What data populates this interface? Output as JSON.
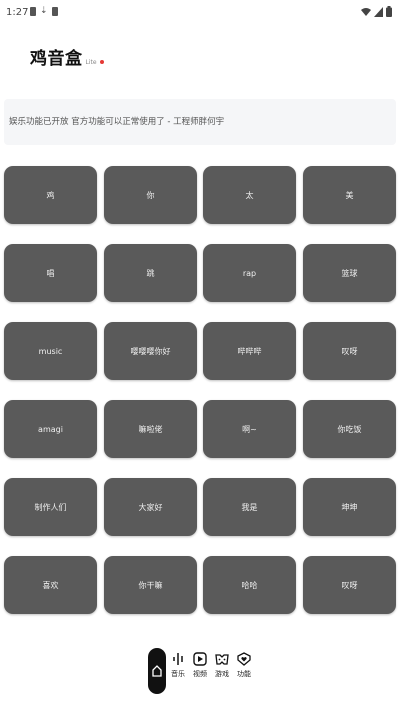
{
  "status_bar": {
    "time": "1:27"
  },
  "header": {
    "title": "鸡音盒",
    "badge": "Lite"
  },
  "notice": {
    "text": "娱乐功能已开放 官方功能可以正常使用了 - 工程师胖何宇"
  },
  "grid": {
    "buttons": [
      [
        "鸡",
        "你",
        "太",
        "美"
      ],
      [
        "唱",
        "跳",
        "rap",
        "篮球"
      ],
      [
        "music",
        "嘤嘤嘤你好",
        "哔哔哔",
        "叹呀"
      ],
      [
        "amagi",
        "嘛啦佬",
        "啊~",
        "你吃饭"
      ],
      [
        "制作人们",
        "大家好",
        "我是",
        "坤坤"
      ],
      [
        "喜欢",
        "你干嘛",
        "哈哈",
        "叹呀"
      ]
    ]
  },
  "nav": {
    "music": "音乐",
    "video": "视频",
    "game": "游戏",
    "feature": "功能"
  }
}
